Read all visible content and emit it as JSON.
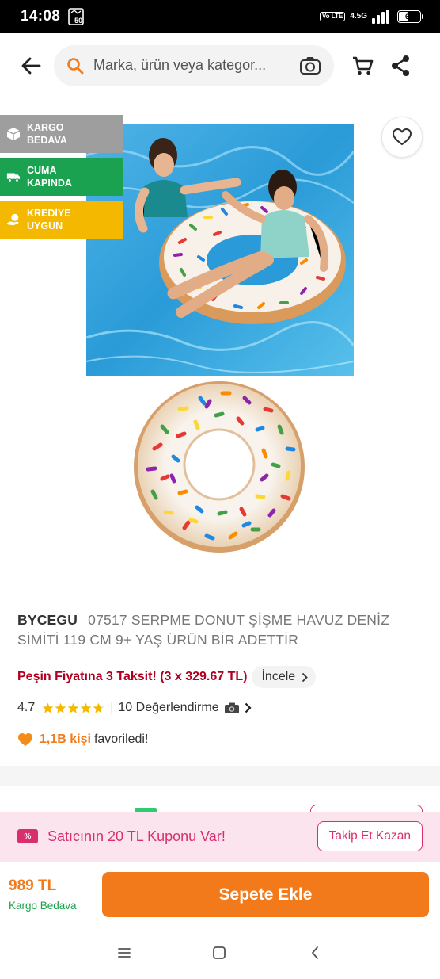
{
  "status_bar": {
    "time": "14:08",
    "notification_badge": "50",
    "volte_label": "Vo LTE",
    "network_label": "4.5G",
    "battery_level": "65"
  },
  "header": {
    "search_placeholder": "Marka, ürün veya kategor...",
    "icons": {
      "back": "arrow-left-icon",
      "search": "search-icon",
      "camera": "camera-search-icon",
      "cart": "cart-icon",
      "share": "share-icon"
    }
  },
  "badges": [
    {
      "line1": "KARGO",
      "line2": "BEDAVA",
      "color": "#9e9e9e",
      "icon": "box-icon"
    },
    {
      "line1": "CUMA",
      "line2": "KAPINDA",
      "color": "#1aa251",
      "icon": "truck-icon"
    },
    {
      "line1": "KREDİYE",
      "line2": "UYGUN",
      "color": "#f5b800",
      "icon": "coins-icon"
    }
  ],
  "product": {
    "brand": "BYCEGU",
    "name": "07517 SERPME DONUT ŞİŞME HAVUZ DENİZ SİMİTİ 119 CM 9+ YAŞ ÜRÜN BİR ADETTİR",
    "installment_text": "Peşin Fiyatına 3 Taksit! (3 x 329.67 TL)",
    "installment_link": "İncele",
    "rating": "4.7",
    "rating_value": 4.7,
    "review_count": "10 Değerlendirme",
    "favorite_count": "1,1B kişi",
    "favorite_suffix": "favoriledi!"
  },
  "coupon": {
    "badge": "%",
    "text": "Satıcının 20 TL Kuponu Var!",
    "button": "Takip Et Kazan"
  },
  "bottom_bar": {
    "price": "989 TL",
    "shipping": "Kargo Bedava",
    "add_to_cart": "Sepete Ekle"
  },
  "colors": {
    "brand_orange": "#f27a1a",
    "installment_red": "#b00020",
    "coupon_pink": "#d9306d",
    "shipping_green": "#18a34a"
  }
}
